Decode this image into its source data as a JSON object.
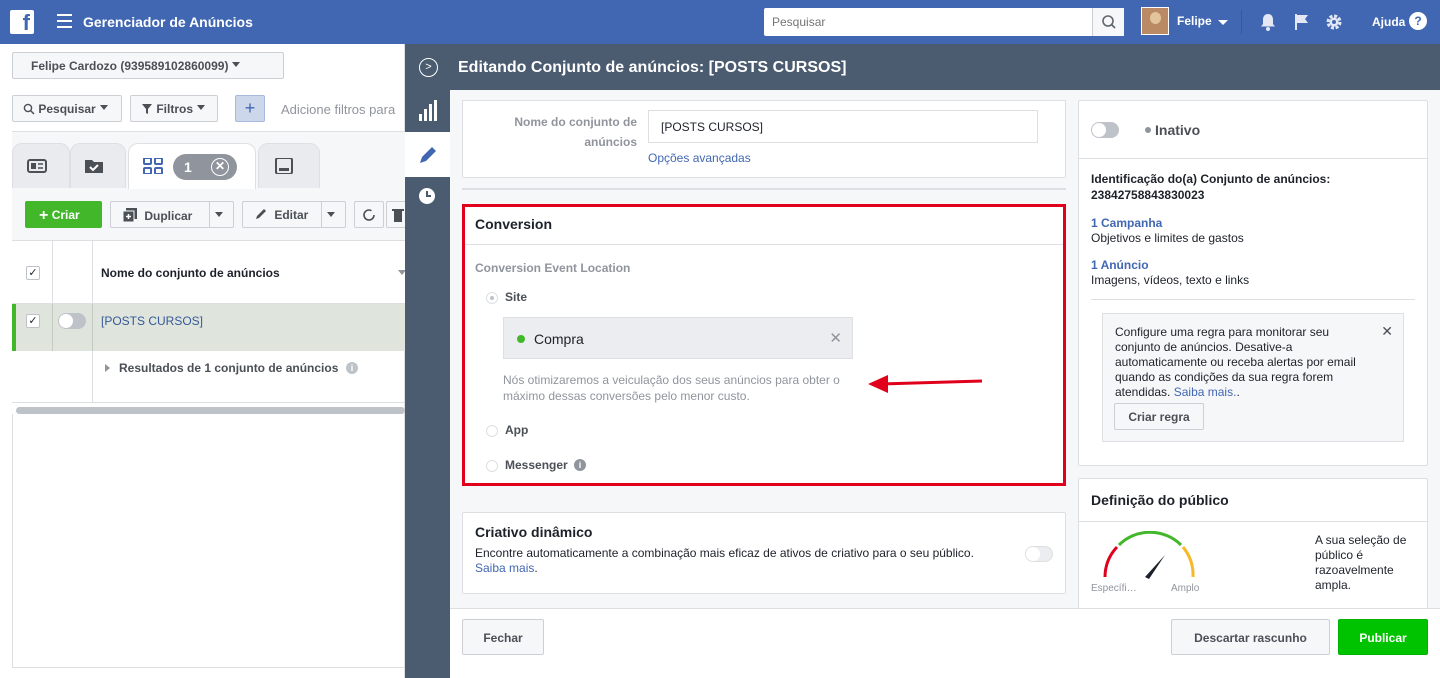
{
  "topbar": {
    "logo": "f",
    "app_title": "Gerenciador de Anúncios",
    "search_placeholder": "Pesquisar",
    "user_name": "Felipe",
    "help_label": "Ajuda",
    "help_glyph": "?"
  },
  "left": {
    "account": "Felipe Cardozo (939589102860099)",
    "search_label": "Pesquisar",
    "filters_label": "Filtros",
    "plus": "+",
    "filter_hint": "Adicione filtros para",
    "tab_count": "1",
    "create_label": "Criar",
    "duplicate_label": "Duplicar",
    "edit_label": "Editar",
    "column_header": "Nome do conjunto de anúncios",
    "row_name": "[POSTS CURSOS]",
    "results_label": "Resultados de 1 conjunto de anúncios"
  },
  "panel": {
    "title": "Editando Conjunto de anúncios: [POSTS CURSOS]",
    "name_label": "Nome do conjunto de anúncios",
    "name_value": "[POSTS CURSOS]",
    "advanced_link": "Opções avançadas",
    "conversion": {
      "heading": "Conversion",
      "location_label": "Conversion Event Location",
      "options": [
        "Site",
        "App",
        "Messenger"
      ],
      "selected": "Site",
      "event": "Compra",
      "helper": "Nós otimizaremos a veiculação dos seus anúncios para obter o máximo dessas conversões pelo menor custo."
    },
    "dynamic": {
      "title": "Criativo dinâmico",
      "desc": "Encontre automaticamente a combinação mais eficaz de ativos de criativo para o seu público.",
      "link": "Saiba mais",
      "link_suffix": "."
    },
    "status": {
      "label": "Inativo",
      "id_label": "Identificação do(a) Conjunto de anúncios:",
      "id_value": "23842758843830023",
      "campaign_link": "1 Campanha",
      "campaign_desc": "Objetivos e limites de gastos",
      "ad_link": "1 Anúncio",
      "ad_desc": "Imagens, vídeos, texto e links"
    },
    "rule": {
      "text": "Configure uma regra para monitorar seu conjunto de anúncios. Desative-a automaticamente ou receba alertas por email quando as condições da sua regra forem atendidas.",
      "link": "Saiba mais.",
      "link_suffix": ".",
      "button": "Criar regra"
    },
    "audience": {
      "title": "Definição do público",
      "specific": "Específi…",
      "broad": "Amplo",
      "desc": "A sua seleção de público é razoavelmente ampla."
    },
    "footer": {
      "close": "Fechar",
      "discard": "Descartar rascunho",
      "publish": "Publicar"
    }
  },
  "colors": {
    "topbar": "#4267b2",
    "panel_header": "#4b5c70",
    "highlight_border": "#e0001b",
    "publish_green": "#00c300",
    "arrow_red": "#e0001b"
  }
}
